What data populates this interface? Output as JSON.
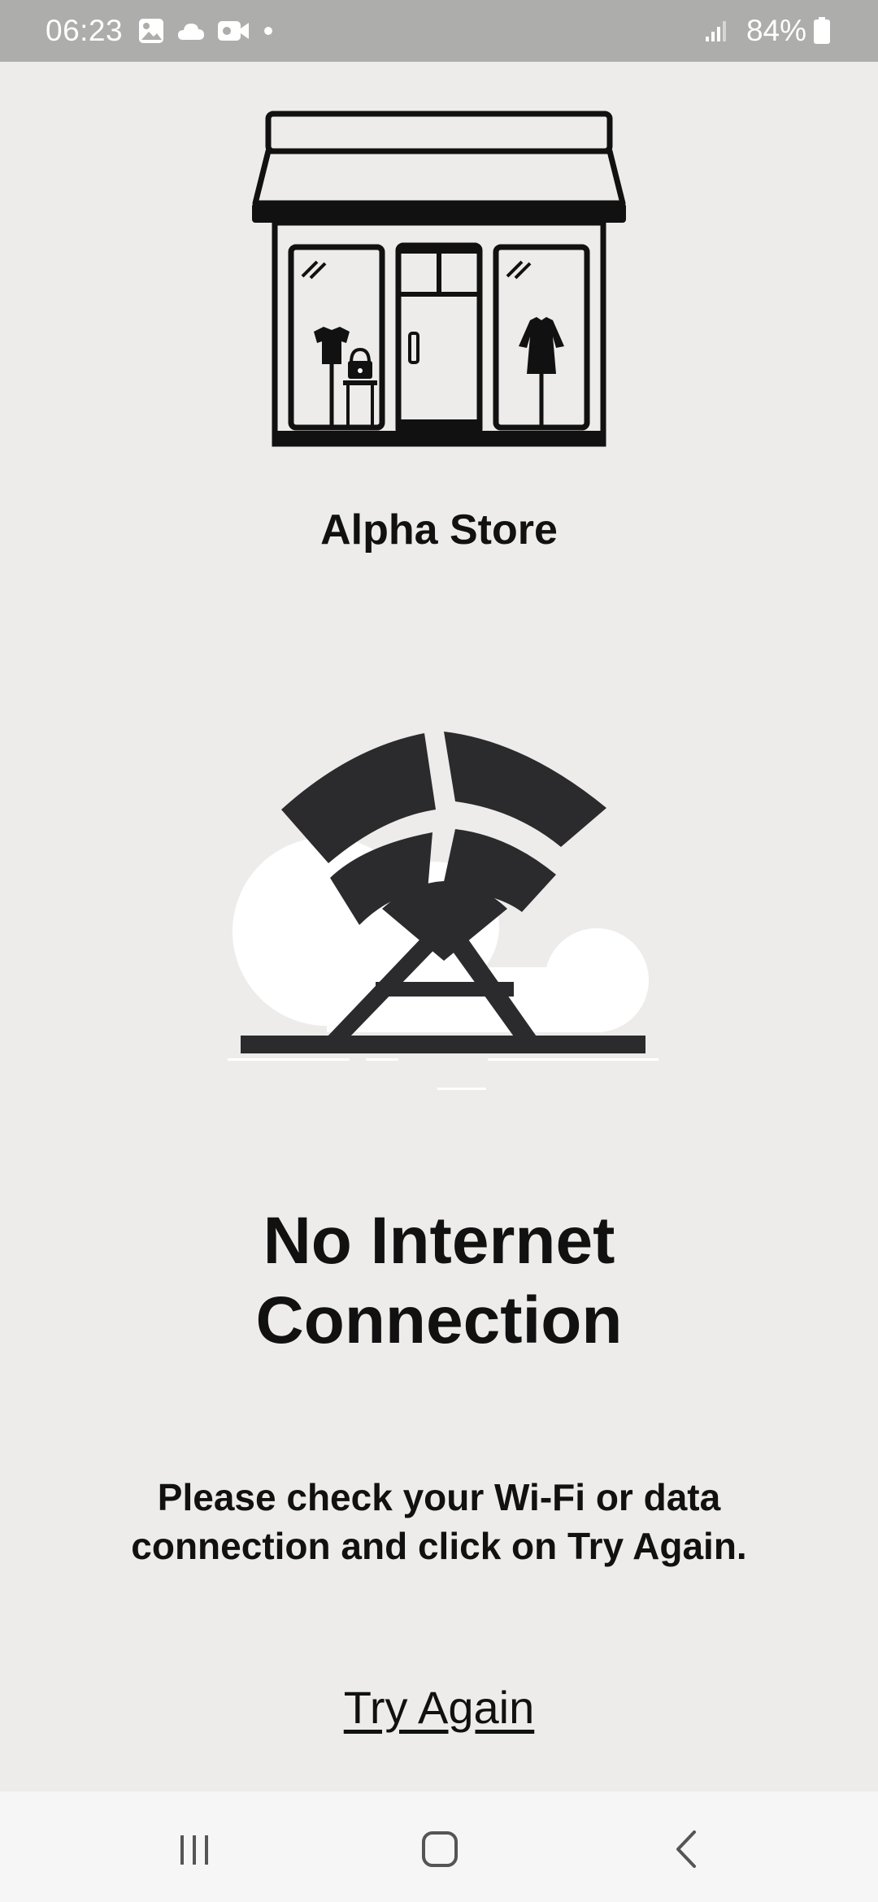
{
  "status_bar": {
    "time": "06:23",
    "battery_percent": "84%",
    "icons": [
      "gallery-icon",
      "cloud-icon",
      "video-icon",
      "notification-dot",
      "signal-icon",
      "battery-icon"
    ]
  },
  "store": {
    "name": "Alpha Store",
    "logo_icon": "storefront-icon"
  },
  "error": {
    "illustration_icon": "no-signal-tower-icon",
    "title_line1": "No Internet",
    "title_line2": "Connection",
    "message_line1": "Please check your Wi-Fi or data",
    "message_line2": "connection and click on Try Again."
  },
  "actions": {
    "try_again_label": "Try Again"
  },
  "nav_bar": {
    "icons": [
      "recent-apps-icon",
      "home-icon",
      "back-icon"
    ]
  },
  "colors": {
    "background": "#edecea",
    "status_bar": "#adadab",
    "nav_bar": "#f6f6f6",
    "illustration_dark": "#2b2b2d",
    "text": "#111111"
  }
}
